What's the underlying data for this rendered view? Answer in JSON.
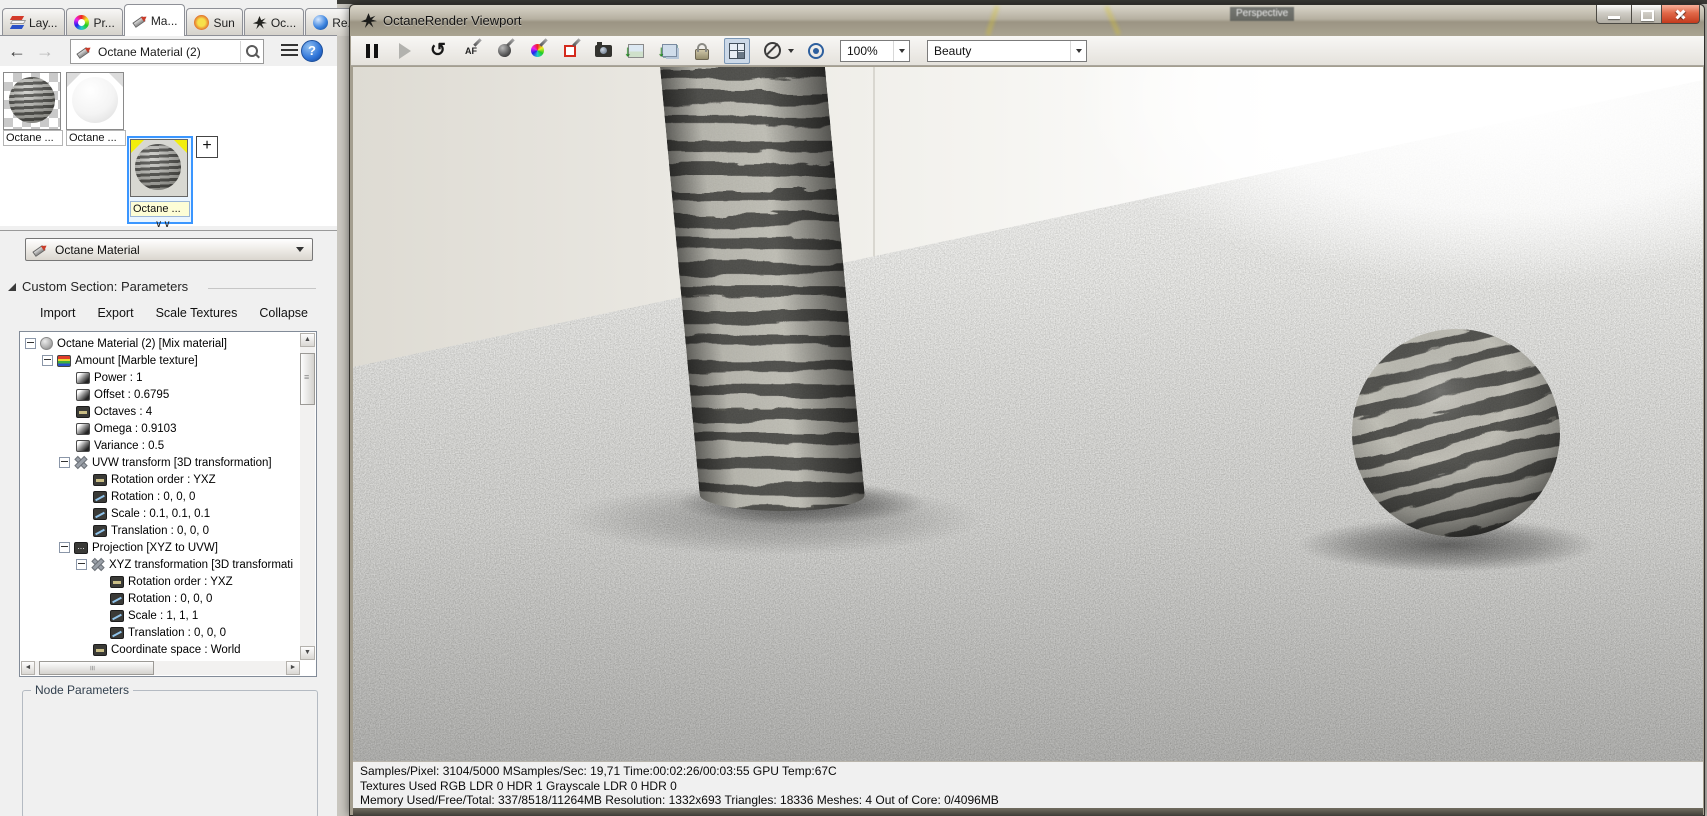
{
  "background": {
    "perspective_label": "Perspective"
  },
  "left_panel": {
    "tabs": [
      {
        "label": "Lay..."
      },
      {
        "label": "Pr..."
      },
      {
        "label": "Ma...",
        "active": true
      },
      {
        "label": "Sun"
      },
      {
        "label": "Oc..."
      },
      {
        "label": "Re..."
      }
    ],
    "nav": {
      "search_value": "Octane Material (2)"
    },
    "swatches": [
      {
        "label": "Octane ..."
      },
      {
        "label": "Octane ..."
      },
      {
        "label": "Octane ...",
        "selected": true
      }
    ],
    "add_button_label": "+",
    "material_type_dropdown": {
      "value": "Octane Material"
    },
    "section_header": "Custom Section: Parameters",
    "actions": [
      {
        "label": "Import"
      },
      {
        "label": "Export"
      },
      {
        "label": "Scale Textures"
      },
      {
        "label": "Collapse"
      }
    ],
    "tree": [
      {
        "label": "Octane Material (2)  [Mix material]"
      },
      {
        "label": "Amount  [Marble texture]"
      },
      {
        "label": "Power : 1"
      },
      {
        "label": "Offset : 0.6795"
      },
      {
        "label": "Octaves : 4"
      },
      {
        "label": "Omega : 0.9103"
      },
      {
        "label": "Variance : 0.5"
      },
      {
        "label": "UVW transform  [3D transformation]"
      },
      {
        "label": "Rotation order : YXZ"
      },
      {
        "label": "Rotation : 0, 0, 0"
      },
      {
        "label": "Scale : 0.1, 0.1, 0.1"
      },
      {
        "label": "Translation : 0, 0, 0"
      },
      {
        "label": "Projection  [XYZ to UVW]"
      },
      {
        "label": "XYZ transformation  [3D transformati"
      },
      {
        "label": "Rotation order : YXZ"
      },
      {
        "label": "Rotation : 0, 0, 0"
      },
      {
        "label": "Scale : 1, 1, 1"
      },
      {
        "label": "Translation : 0, 0, 0"
      },
      {
        "label": "Coordinate space : World"
      }
    ],
    "node_parameters_label": "Node Parameters"
  },
  "viewport": {
    "title": "OctaneRender Viewport",
    "toolbar": {
      "zoom_value": "100%",
      "render_pass": "Beauty"
    },
    "status": {
      "line1": "Samples/Pixel: 3104/5000  MSamples/Sec: 19,71  Time:00:02:26/00:03:55  GPU Temp:67C",
      "line2": "Textures Used RGB LDR 0  HDR 1  Grayscale LDR 0  HDR 0",
      "line3": "Memory Used/Free/Total: 337/8518/11264MB  Resolution: 1332x693  Triangles: 18336  Meshes: 4 Out of Core: 0/4096MB"
    }
  },
  "icons": {
    "accent_selection_color": "#3a96ff",
    "close_button_color": "#c33a1d",
    "named": [
      "layers-icon",
      "color-wheel-icon",
      "paint-tube-icon",
      "sun-icon",
      "octane-turbine-icon",
      "render-sphere-icon",
      "search-icon",
      "menu-icon",
      "help-icon",
      "pause-icon",
      "play-icon",
      "restart-icon",
      "autofocus-picker-icon",
      "material-picker-icon",
      "white-balance-picker-icon",
      "region-picker-icon",
      "camera-icon",
      "save-image-icon",
      "save-passes-icon",
      "lock-icon",
      "quad-view-icon",
      "clay-mode-icon",
      "focus-icon"
    ]
  }
}
